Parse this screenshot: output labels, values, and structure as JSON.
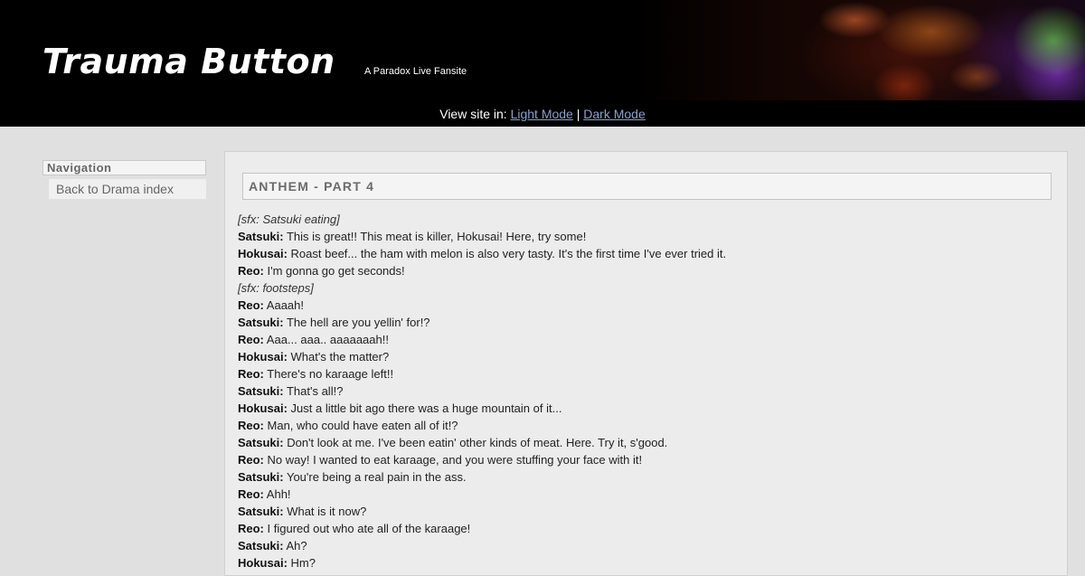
{
  "header": {
    "title": "Trauma Button",
    "subtitle": "A Paradox Live Fansite",
    "mode_prefix": "View site in:",
    "mode_light": "Light Mode",
    "mode_separator": "|",
    "mode_dark": "Dark Mode"
  },
  "sidebar": {
    "heading": "Navigation",
    "links": [
      "Back to Drama index"
    ]
  },
  "main": {
    "title": "ANTHEM - PART 4",
    "lines": [
      {
        "sfx": "[sfx: Satsuki eating]"
      },
      {
        "speaker": "Satsuki:",
        "text": "This is great!! This meat is killer, Hokusai! Here, try some!"
      },
      {
        "speaker": "Hokusai:",
        "text": "Roast beef... the ham with melon is also very tasty. It's the first time I've ever tried it."
      },
      {
        "speaker": "Reo:",
        "text": "I'm gonna go get seconds!"
      },
      {
        "sfx": "[sfx: footsteps]"
      },
      {
        "speaker": "Reo:",
        "text": "Aaaah!"
      },
      {
        "speaker": "Satsuki:",
        "text": "The hell are you yellin' for!?"
      },
      {
        "speaker": "Reo:",
        "text": "Aaa... aaa.. aaaaaaah!!"
      },
      {
        "speaker": "Hokusai:",
        "text": "What's the matter?"
      },
      {
        "speaker": "Reo:",
        "text": "There's no karaage left!!"
      },
      {
        "speaker": "Satsuki:",
        "text": "That's all!?"
      },
      {
        "speaker": "Hokusai:",
        "text": "Just a little bit ago there was a huge mountain of it..."
      },
      {
        "speaker": "Reo:",
        "text": "Man, who could have eaten all of it!?"
      },
      {
        "speaker": "Satsuki:",
        "text": "Don't look at me. I've been eatin' other kinds of meat. Here. Try it, s'good."
      },
      {
        "speaker": "Reo:",
        "text": "No way! I wanted to eat karaage, and you were stuffing your face with it!"
      },
      {
        "speaker": "Satsuki:",
        "text": "You're being a real pain in the ass."
      },
      {
        "speaker": "Reo:",
        "text": "Ahh!"
      },
      {
        "speaker": "Satsuki:",
        "text": "What is it now?"
      },
      {
        "speaker": "Reo:",
        "text": "I figured out who ate all of the karaage!"
      },
      {
        "speaker": "Satsuki:",
        "text": "Ah?"
      },
      {
        "speaker": "Hokusai:",
        "text": "Hm?"
      }
    ]
  }
}
